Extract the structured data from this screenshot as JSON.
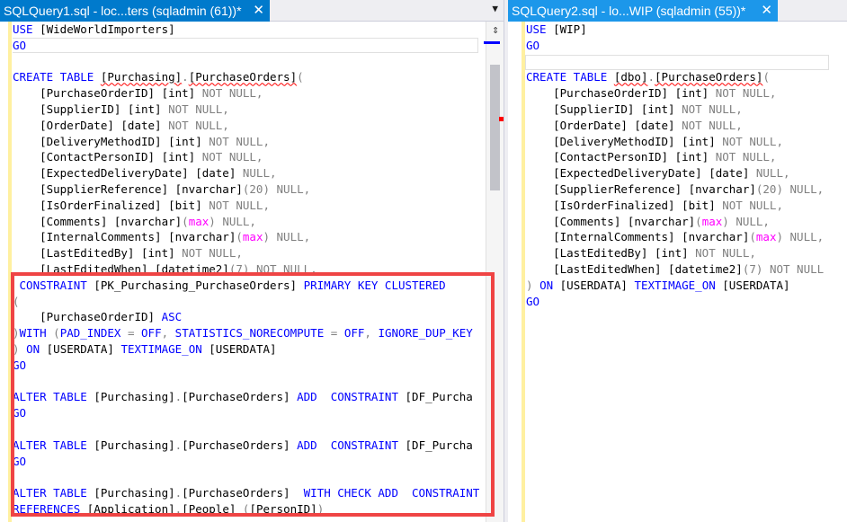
{
  "tabs": {
    "left": {
      "title": "SQLQuery1.sql - loc...ters (sqladmin (61))*",
      "close": "✕",
      "dropdown": "▼"
    },
    "right": {
      "title": "SQLQuery2.sql - lo...WIP (sqladmin (55))*",
      "close": "✕"
    }
  },
  "scrollbar": {
    "split_icon": "⇕"
  },
  "left_code": {
    "l1": {
      "a": "USE ",
      "b": "[WideWorldImporters]"
    },
    "l2": {
      "a": "GO"
    },
    "l4": {
      "a": "CREATE TABLE ",
      "b": "[Purchasing]",
      "c": ".",
      "d": "[PurchaseOrders]",
      "e": "("
    },
    "l5": {
      "a": "    [PurchaseOrderID] [int] ",
      "b": "NOT NULL,"
    },
    "l6": {
      "a": "    [SupplierID] [int] ",
      "b": "NOT NULL,"
    },
    "l7": {
      "a": "    [OrderDate] [date] ",
      "b": "NOT NULL,"
    },
    "l8": {
      "a": "    [DeliveryMethodID] [int] ",
      "b": "NOT NULL,"
    },
    "l9": {
      "a": "    [ContactPersonID] [int] ",
      "b": "NOT NULL,"
    },
    "l10": {
      "a": "    [ExpectedDeliveryDate] [date] ",
      "b": "NULL,"
    },
    "l11": {
      "a": "    [SupplierReference] [nvarchar]",
      "b": "(20) ",
      "c": "NULL,"
    },
    "l12": {
      "a": "    [IsOrderFinalized] [bit] ",
      "b": "NOT NULL,"
    },
    "l13": {
      "a": "    [Comments] [nvarchar]",
      "b": "(",
      "c": "max",
      "d": ") ",
      "e": "NULL,"
    },
    "l14": {
      "a": "    [InternalComments] [nvarchar]",
      "b": "(",
      "c": "max",
      "d": ") ",
      "e": "NULL,"
    },
    "l15": {
      "a": "    [LastEditedBy] [int] ",
      "b": "NOT NULL,"
    },
    "l16": {
      "a": "    [LastEditedWhen] [datetime2]",
      "b": "(7) ",
      "c": "NOT NULL,"
    },
    "l17": {
      "a": " CONSTRAINT ",
      "b": "[PK_Purchasing_PurchaseOrders] ",
      "c": "PRIMARY KEY CLUSTERED"
    },
    "l18": {
      "a": "("
    },
    "l19": {
      "a": "    [PurchaseOrderID] ",
      "b": "ASC"
    },
    "l20": {
      "a": ")WITH ",
      "b": "(",
      "c": "PAD_INDEX ",
      "d": "= ",
      "e": "OFF",
      "f": ", ",
      "g": "STATISTICS_NORECOMPUTE ",
      "h": "= ",
      "i": "OFF",
      "j": ", ",
      "k": "IGNORE_DUP_KEY"
    },
    "l21": {
      "a": ") ",
      "b": "ON ",
      "c": "[USERDATA] ",
      "d": "TEXTIMAGE_ON ",
      "e": "[USERDATA]"
    },
    "l22": {
      "a": "GO"
    },
    "l24": {
      "a": "ALTER TABLE ",
      "b": "[Purchasing]",
      "c": ".",
      "d": "[PurchaseOrders] ",
      "e": "ADD  CONSTRAINT ",
      "f": "[DF_Purcha"
    },
    "l25": {
      "a": "GO"
    },
    "l27": {
      "a": "ALTER TABLE ",
      "b": "[Purchasing]",
      "c": ".",
      "d": "[PurchaseOrders] ",
      "e": "ADD  CONSTRAINT ",
      "f": "[DF_Purcha"
    },
    "l28": {
      "a": "GO"
    },
    "l30": {
      "a": "ALTER TABLE ",
      "b": "[Purchasing]",
      "c": ".",
      "d": "[PurchaseOrders]  ",
      "e": "WITH CHECK ADD  CONSTRAINT"
    },
    "l31": {
      "a": "REFERENCES ",
      "b": "[Application]",
      "c": ".",
      "d": "[People] ",
      "e": "(",
      "f": "[PersonID]",
      "g": ")"
    }
  },
  "right_code": {
    "l1": {
      "a": "USE ",
      "b": "[WIP]"
    },
    "l2": {
      "a": "GO"
    },
    "l4": {
      "a": "CREATE TABLE ",
      "b": "[dbo]",
      "c": ".",
      "d": "[PurchaseOrders]",
      "e": "("
    },
    "l5": {
      "a": "    [PurchaseOrderID] [int] ",
      "b": "NOT NULL,"
    },
    "l6": {
      "a": "    [SupplierID] [int] ",
      "b": "NOT NULL,"
    },
    "l7": {
      "a": "    [OrderDate] [date] ",
      "b": "NOT NULL,"
    },
    "l8": {
      "a": "    [DeliveryMethodID] [int] ",
      "b": "NOT NULL,"
    },
    "l9": {
      "a": "    [ContactPersonID] [int] ",
      "b": "NOT NULL,"
    },
    "l10": {
      "a": "    [ExpectedDeliveryDate] [date] ",
      "b": "NULL,"
    },
    "l11": {
      "a": "    [SupplierReference] [nvarchar]",
      "b": "(20) ",
      "c": "NULL,"
    },
    "l12": {
      "a": "    [IsOrderFinalized] [bit] ",
      "b": "NOT NULL,"
    },
    "l13": {
      "a": "    [Comments] [nvarchar]",
      "b": "(",
      "c": "max",
      "d": ") ",
      "e": "NULL,"
    },
    "l14": {
      "a": "    [InternalComments] [nvarchar]",
      "b": "(",
      "c": "max",
      "d": ") ",
      "e": "NULL,"
    },
    "l15": {
      "a": "    [LastEditedBy] [int] ",
      "b": "NOT NULL,"
    },
    "l16": {
      "a": "    [LastEditedWhen] [datetime2]",
      "b": "(7) ",
      "c": "NOT NULL"
    },
    "l17": {
      "a": ") ",
      "b": "ON ",
      "c": "[USERDATA] ",
      "d": "TEXTIMAGE_ON ",
      "e": "[USERDATA]"
    },
    "l18": {
      "a": "GO"
    }
  },
  "colors": {
    "keyword": "#0000ff",
    "function": "#ff00ff",
    "gray": "#808080",
    "tab_active": "#007acc",
    "tab_inactive": "#1c97ea",
    "highlight": "#ef4444"
  }
}
